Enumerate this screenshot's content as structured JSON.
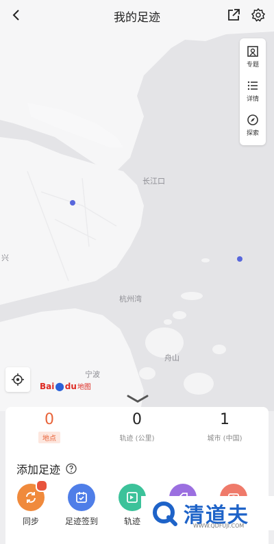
{
  "header": {
    "title": "我的足迹",
    "back_icon": "chevron-left-icon",
    "share_icon": "share-icon",
    "settings_icon": "gear-icon"
  },
  "map": {
    "labels": {
      "changjiangkou": "长江口",
      "hangzhouwan": "杭州湾",
      "ningbo": "宁波",
      "zhoushan": "舟山",
      "xing": "兴"
    },
    "provider_logo": {
      "bai": "Bai",
      "du": "du",
      "suffix": "地图"
    },
    "colors": {
      "land": "#f6f6f7",
      "water": "#e3e3e6",
      "marker": "#5867dc"
    }
  },
  "side_panel": {
    "items": [
      {
        "label": "专题",
        "icon": "topic-icon"
      },
      {
        "label": "详情",
        "icon": "list-icon"
      },
      {
        "label": "探索",
        "icon": "explore-icon"
      }
    ]
  },
  "stats": [
    {
      "value": "0",
      "label": "地点"
    },
    {
      "value": "0",
      "label": "轨迹 (公里)"
    },
    {
      "value": "1",
      "label": "城市 (中国)"
    }
  ],
  "add_section": {
    "title": "添加足迹",
    "actions": [
      {
        "label": "同步",
        "color": "#f08a3c",
        "icon": "sync-icon"
      },
      {
        "label": "足迹签到",
        "color": "#4f7ee8",
        "icon": "checkin-icon"
      },
      {
        "label": "轨迹",
        "color": "#3cc29a",
        "icon": "track-icon"
      },
      {
        "label": "",
        "color": "#9b6fe0",
        "icon": "tag-icon"
      },
      {
        "label": "",
        "color": "#ef7a6a",
        "icon": "photo-icon"
      }
    ]
  },
  "watermark": {
    "brand": "清道夫",
    "url": "WWW.QDFUJI.COM"
  }
}
